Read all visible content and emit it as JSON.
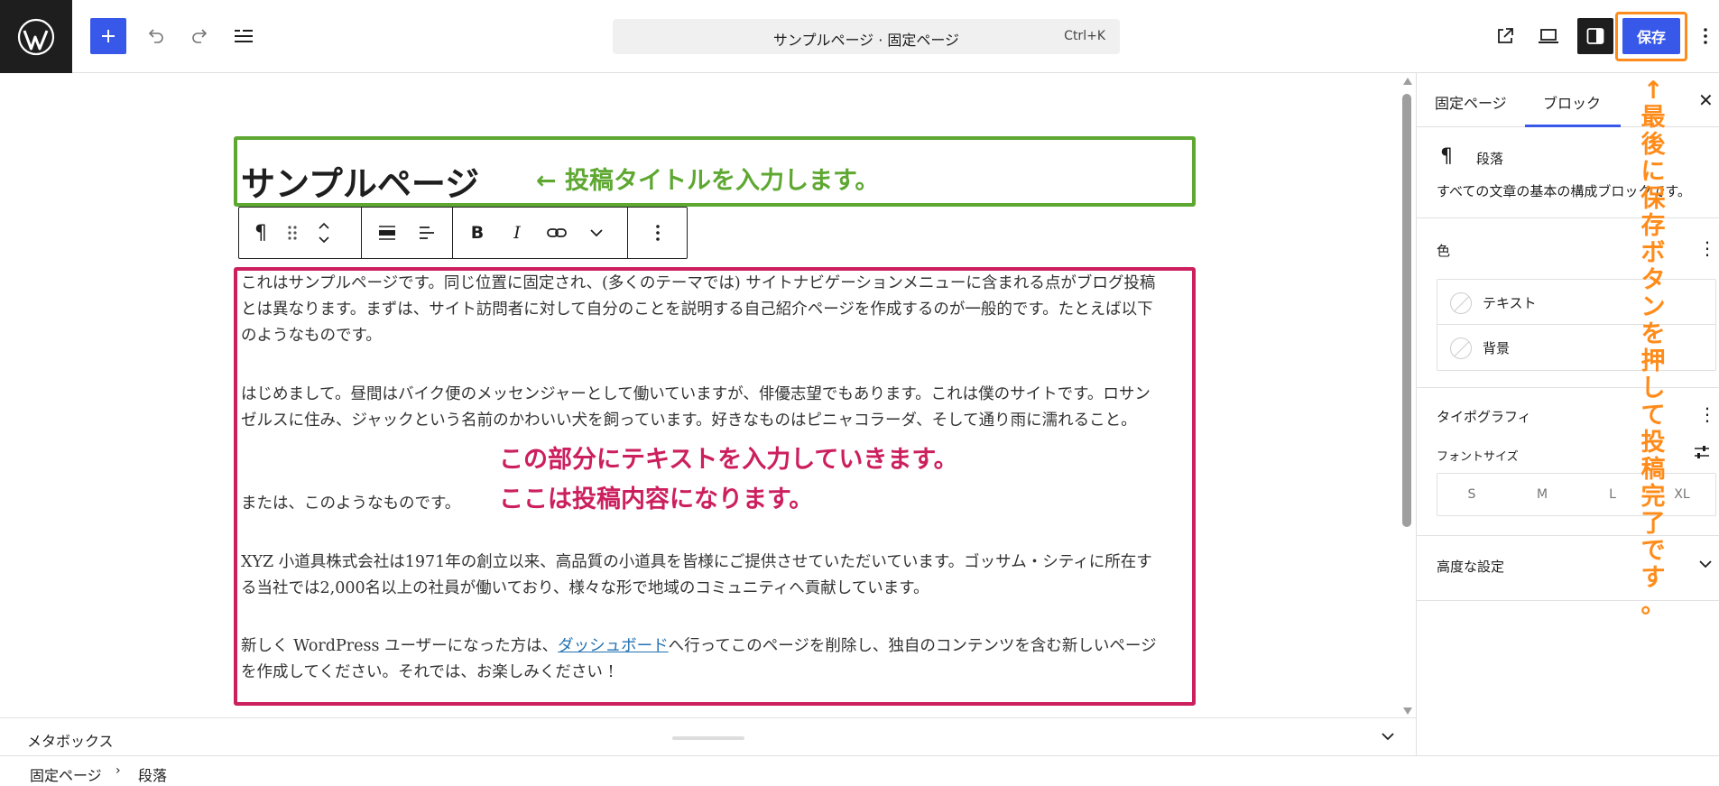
{
  "toolbar": {
    "document_title": "サンプルページ · 固定ページ",
    "shortcut": "Ctrl+K",
    "save_label": "保存"
  },
  "editor": {
    "title": "サンプルページ",
    "title_annotation": "← 投稿タイトルを入力します。",
    "content_annotation_1": "この部分にテキストを入力していきます。",
    "content_annotation_2": "ここは投稿内容になります。",
    "paragraphs": [
      "これはサンプルページです。同じ位置に固定され、(多くのテーマでは) サイトナビゲーションメニューに含まれる点がブログ投稿とは異なります。まずは、サイト訪問者に対して自分のことを説明する自己紹介ページを作成するのが一般的です。たとえば以下のようなものです。",
      "はじめまして。昼間はバイク便のメッセンジャーとして働いていますが、俳優志望でもあります。これは僕のサイトです。ロサンゼルスに住み、ジャックという名前のかわいい犬を飼っています。好きなものはピニャコラーダ、そして通り雨に濡れること。",
      "または、このようなものです。",
      "XYZ 小道具株式会社は1971年の創立以来、高品質の小道具を皆様にご提供させていただいています。ゴッサム・シティに所在する当社では2,000名以上の社員が働いており、様々な形で地域のコミュニティへ貢献しています。"
    ],
    "last_paragraph": {
      "before": "新しく WordPress ユーザーになった方は、",
      "link": "ダッシュボード",
      "after": "へ行ってこのページを削除し、独自のコンテンツを含む新しいページを作成してください。それでは、お楽しみください !"
    }
  },
  "metabox": {
    "label": "メタボックス"
  },
  "breadcrumb": {
    "items": [
      "固定ページ",
      "段落"
    ]
  },
  "sidebar": {
    "tabs": [
      "固定ページ",
      "ブロック"
    ],
    "active_tab": "ブロック",
    "block_name": "段落",
    "block_description": "すべての文章の基本の構成ブロックです。",
    "color_section": "色",
    "color_items": [
      "テキスト",
      "背景"
    ],
    "typography_section": "タイポグラフィ",
    "font_size_label": "フォントサイズ",
    "font_sizes": [
      "S",
      "M",
      "L",
      "XL"
    ],
    "advanced_section": "高度な設定"
  },
  "save_annotation": [
    "↑",
    "最",
    "後",
    "に",
    "保",
    "存",
    "ボ",
    "タ",
    "ン",
    "を",
    "押",
    "し",
    "て",
    "投",
    "稿",
    "完",
    "了",
    "で",
    "す",
    "。"
  ],
  "colors": {
    "accent": "#3858e9",
    "title_box": "#5ea832",
    "content_box": "#cc1f5e",
    "save_annotation": "#ff8c1a",
    "link": "#2271b1"
  }
}
